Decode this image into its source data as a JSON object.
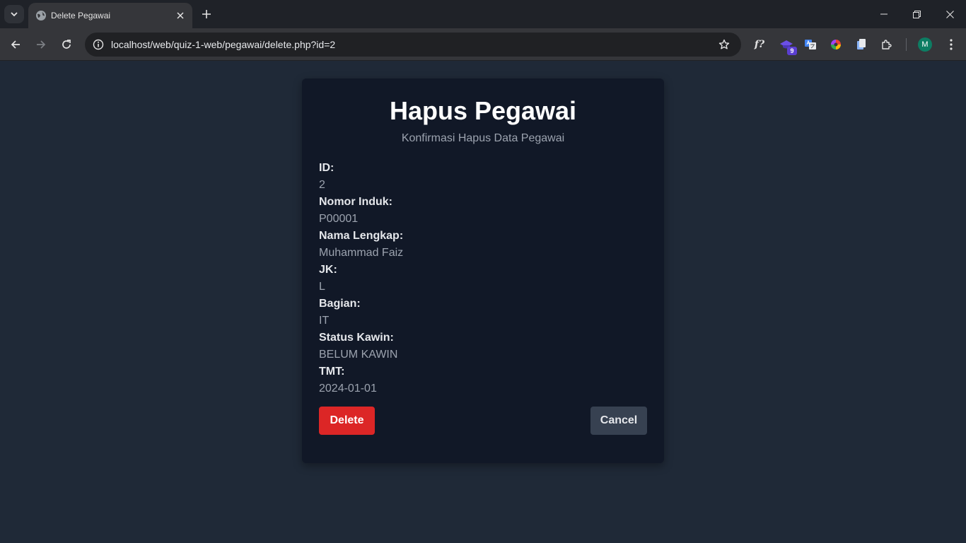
{
  "browser": {
    "tab_title": "Delete Pegawai",
    "url": "localhost/web/quiz-1-web/pegawai/delete.php?id=2",
    "extension_badge": "9",
    "profile_initial": "M"
  },
  "page": {
    "title": "Hapus Pegawai",
    "subtitle": "Konfirmasi Hapus Data Pegawai",
    "fields": [
      {
        "label": "ID:",
        "value": "2"
      },
      {
        "label": "Nomor Induk:",
        "value": "P00001"
      },
      {
        "label": "Nama Lengkap:",
        "value": "Muhammad Faiz"
      },
      {
        "label": "JK:",
        "value": "L"
      },
      {
        "label": "Bagian:",
        "value": "IT"
      },
      {
        "label": "Status Kawin:",
        "value": "BELUM KAWIN"
      },
      {
        "label": "TMT:",
        "value": "2024-01-01"
      }
    ],
    "delete_label": "Delete",
    "cancel_label": "Cancel"
  },
  "colors": {
    "page_bg": "#1f2937",
    "card_bg": "#111827",
    "delete": "#dc2626",
    "cancel": "#374151"
  }
}
